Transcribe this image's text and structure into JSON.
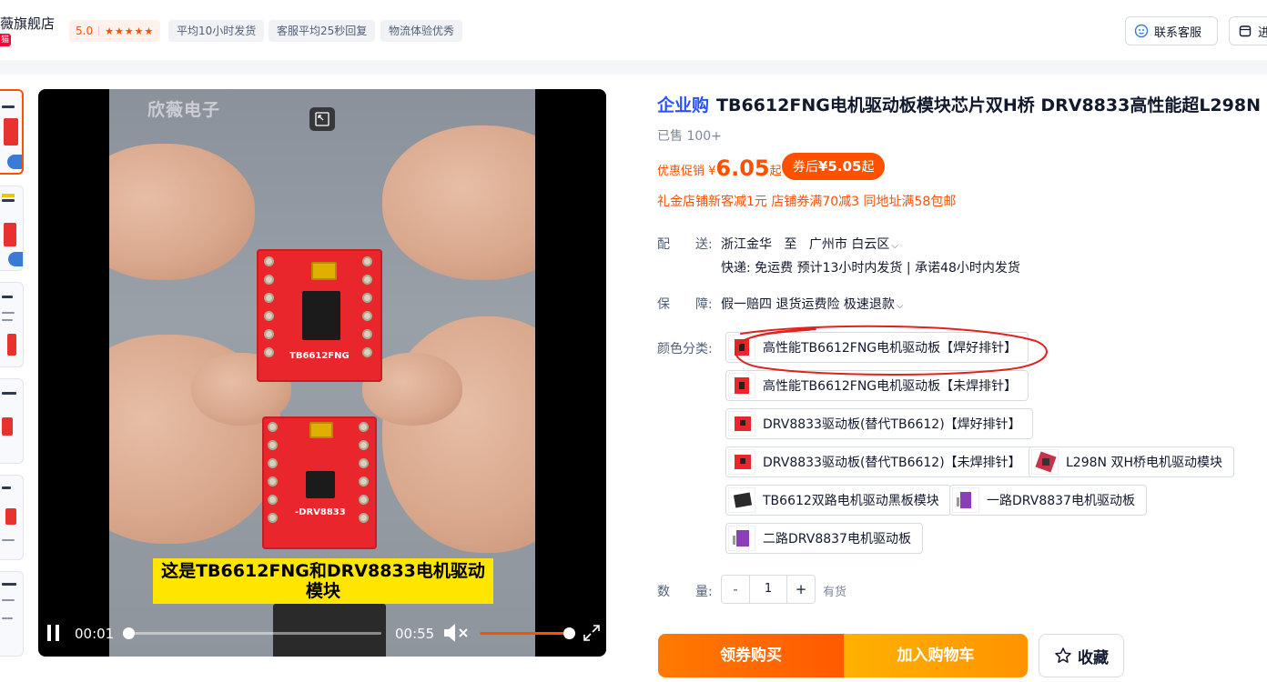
{
  "shop": {
    "name": "薇旗舰店",
    "badge": "猫",
    "rating": "5.0",
    "stars": "★★★★★",
    "tags": [
      "平均10小时发货",
      "客服平均25秒回复",
      "物流体验优秀"
    ],
    "service_label": "联系客服",
    "store_label": "进"
  },
  "video": {
    "watermark": "欣薇电子",
    "subtitle_line1": "这是TB6612FNG和DRV8833电机驱动",
    "subtitle_line2": "模块",
    "board1_label": "TB6612FNG",
    "board2_label": "-DRV8833",
    "current_time": "00:01",
    "total_time": "00:55",
    "progress": 0.02,
    "volume": 1.0,
    "muted": true
  },
  "product": {
    "enterprise_tag": "企业购",
    "title": "TB6612FNG电机驱动板模块芯片双H桥 DRV8833高性能超L298N",
    "sold": "已售 100+",
    "price_label": "优惠促销 ¥",
    "price": "6.05",
    "price_suffix": "起",
    "coupon_prefix": "券后",
    "coupon_price": "¥5.05",
    "coupon_suffix": "起",
    "promo": "礼金店铺新客减1元 店铺券满70减3 同地址满58包邮"
  },
  "delivery": {
    "label": "配　　送:",
    "from": "浙江金华",
    "to_word": "至",
    "to": "广州市 白云区",
    "line2": "快递: 免运费  预计13小时内发货 | 承诺48小时内发货"
  },
  "guarantee": {
    "label": "保　　障:",
    "value": "假一赔四 退货运费险 极速退款"
  },
  "sku": {
    "label": "颜色分类:",
    "options": [
      "高性能TB6612FNG电机驱动板【焊好排针】",
      "高性能TB6612FNG电机驱动板【未焊排针】",
      "DRV8833驱动板(替代TB6612)【焊好排针】",
      "DRV8833驱动板(替代TB6612)【未焊排针】",
      "L298N 双H桥电机驱动模块",
      "TB6612双路电机驱动黑板模块",
      "一路DRV8837电机驱动板",
      "二路DRV8837电机驱动板"
    ]
  },
  "quantity": {
    "label": "数　　量:",
    "minus": "-",
    "value": "1",
    "plus": "+",
    "stock": "有货"
  },
  "actions": {
    "buy": "领券购买",
    "cart": "加入购物车",
    "favorite": "收藏"
  },
  "colors": {
    "accent": "#ff5000",
    "enterprise": "#2953ff",
    "annotation": "#e0231f"
  }
}
